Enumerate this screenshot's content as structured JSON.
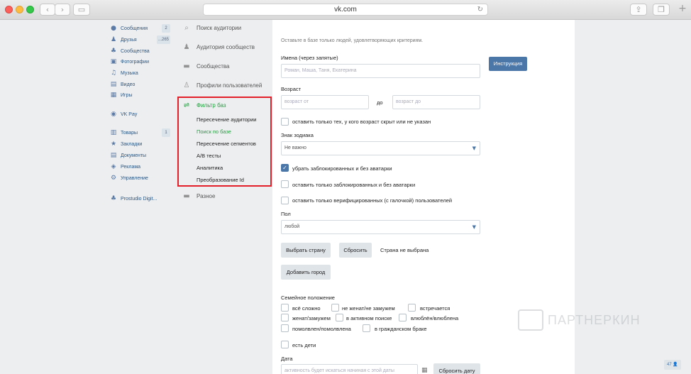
{
  "browser": {
    "url": "vk.com"
  },
  "vk_sidebar": [
    {
      "icon": "user-icon",
      "label": "Сообщения",
      "badge": "2"
    },
    {
      "icon": "friends-icon",
      "label": "Друзья",
      "badge": "...265"
    },
    {
      "icon": "communities-icon",
      "label": "Сообщества"
    },
    {
      "icon": "camera-icon",
      "label": "Фотографии"
    },
    {
      "icon": "music-icon",
      "label": "Музыка"
    },
    {
      "icon": "video-icon",
      "label": "Видео"
    },
    {
      "icon": "games-icon",
      "label": "Игры"
    },
    {
      "icon": "vkpay-icon",
      "label": "VK Pay"
    },
    {
      "icon": "cart-icon",
      "label": "Товары",
      "badge": "1"
    },
    {
      "icon": "star-icon",
      "label": "Закладки"
    },
    {
      "icon": "document-icon",
      "label": "Документы"
    },
    {
      "icon": "ads-icon",
      "label": "Реклама"
    },
    {
      "icon": "manage-icon",
      "label": "Управление"
    },
    {
      "icon": "group-icon",
      "label": "Prostudio Digit..."
    }
  ],
  "tool_menu": {
    "items": [
      {
        "icon": "search-icon",
        "label": "Поиск аудитории"
      },
      {
        "icon": "audience-icon",
        "label": "Аудитория сообществ"
      },
      {
        "icon": "chat-icon",
        "label": "Сообщества"
      },
      {
        "icon": "profile-icon",
        "label": "Профили пользователей"
      },
      {
        "icon": "filter-icon",
        "label": "Фильтр баз"
      }
    ],
    "sub_items": [
      "Пересечение аудитории",
      "Поиск по базе",
      "Пересечение сегментов",
      "А/В тесты",
      "Аналитика",
      "Преобразование Id"
    ],
    "other": {
      "icon": "menu-icon",
      "label": "Разное"
    }
  },
  "form": {
    "intro": "Оставьте в базе только людей, удовлетворяющих критериям.",
    "names_label": "Имена (через запятые)",
    "names_placeholder": "Роман, Маша, Таня, Екатерина",
    "instruction_btn": "Инструкция",
    "age_label": "Возраст",
    "age_from_placeholder": "возраст от",
    "age_to_word": "до",
    "age_to_placeholder": "возраст до",
    "age_hidden_cb": "оставить только тех, у кого возраст скрыт или не указан",
    "zodiac_label": "Знак зодиака",
    "zodiac_value": "Не важно",
    "cb_remove_blocked": "убрать заблокированных и без аватарки",
    "cb_only_blocked": "оставить только заблокированных и без аватарки",
    "cb_verified": "оставить только верифицированных (с галочкой) пользователей",
    "gender_label": "Пол",
    "gender_value": "любой",
    "choose_country_btn": "Выбрать страну",
    "reset_btn": "Сбросить",
    "country_status": "Страна не выбрана",
    "add_city_btn": "Добавить город",
    "family_label": "Семейное положение",
    "family_options": [
      "всё сложно",
      "не женат/не замужем",
      "встречается",
      "женат/замужем",
      "в активном поиске",
      "влюблён/влюблена",
      "помолвлен/помолвлена",
      "в гражданском браке"
    ],
    "kids_cb": "есть дети",
    "date_label": "Дата",
    "date_placeholder": "активность будет искаться начиная с этой даты",
    "reset_date_btn": "Сбросить дату"
  },
  "watermark": "ПАРТНЕРКИН",
  "corner_badge": "47 👤"
}
